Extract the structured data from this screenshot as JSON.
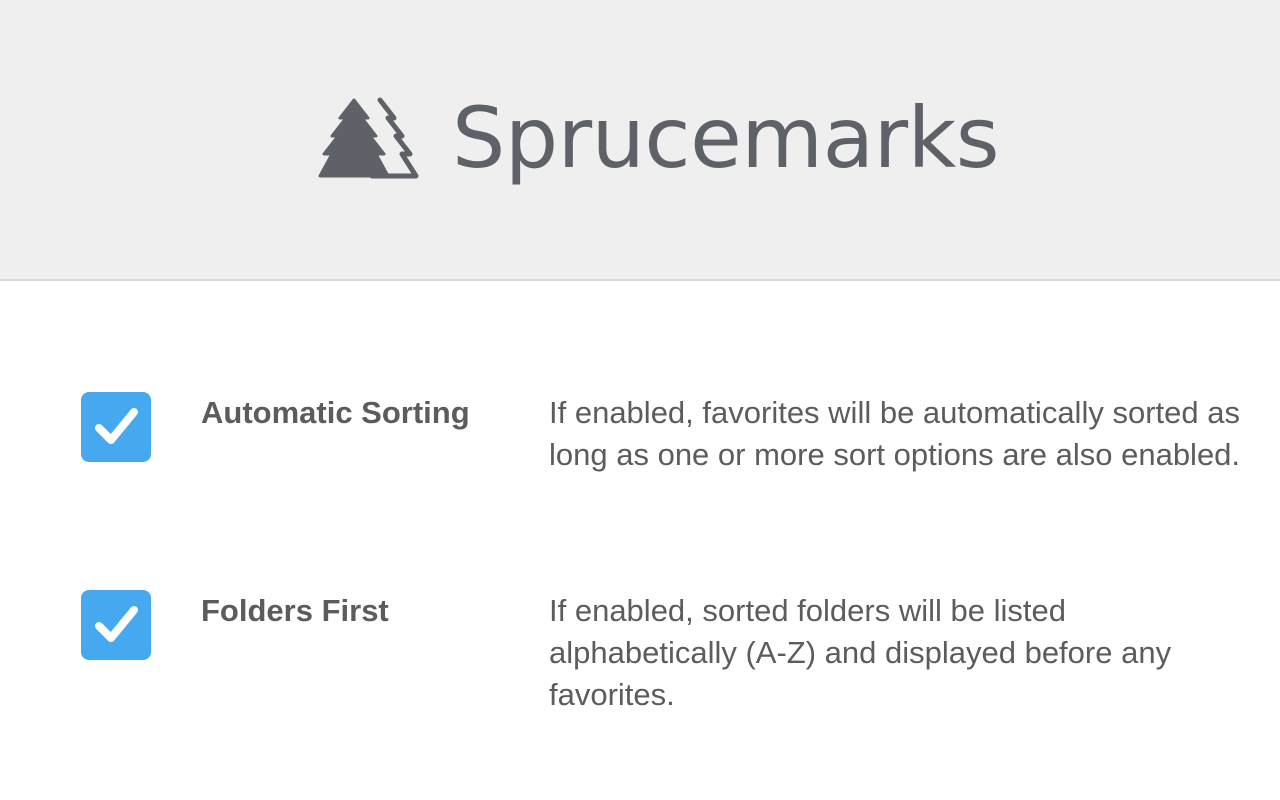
{
  "header": {
    "brand": "Sprucemarks",
    "logo_icon": "spruce-trees-icon",
    "background": "#efefef",
    "brand_color": "#5f6168"
  },
  "options": [
    {
      "label": "Automatic Sorting",
      "description": "If enabled, favorites will be automatically sorted as long as one or more sort options are also enabled.",
      "checked": true
    },
    {
      "label": "Folders First",
      "description": "If enabled, sorted folders will be listed alphabetically (A-Z) and displayed before any favorites.",
      "checked": true
    }
  ],
  "colors": {
    "checkbox": "#46a8ee",
    "text": "#5c5c5c"
  }
}
